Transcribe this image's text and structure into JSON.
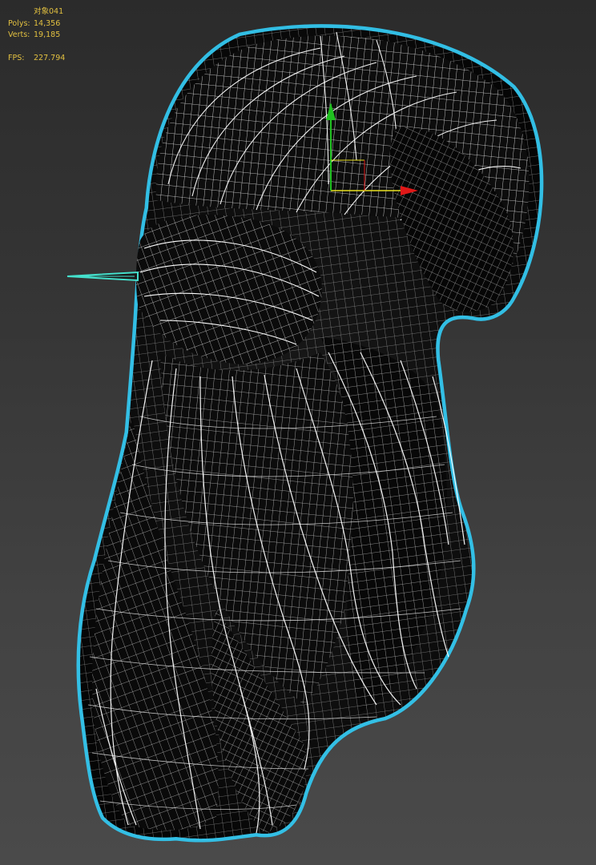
{
  "viewport": {
    "object_name": "对象041",
    "stats": {
      "polys_label": "Polys:",
      "polys_value": "14,356",
      "verts_label": "Verts:",
      "verts_value": "19,185",
      "fps_label": "FPS:",
      "fps_value": "227.794"
    }
  },
  "colors": {
    "stats_text": "#e2c040",
    "selection_outline": "#33c6ee",
    "wireframe": "#ffffff",
    "mesh_fill": "#0a0a0a",
    "gizmo_x": "#e01818",
    "gizmo_y": "#20c020",
    "gizmo_z": "#3060ff"
  },
  "icons": {
    "transform_gizmo": "move-gizmo-icon",
    "hairpin": "hairpin-object"
  }
}
